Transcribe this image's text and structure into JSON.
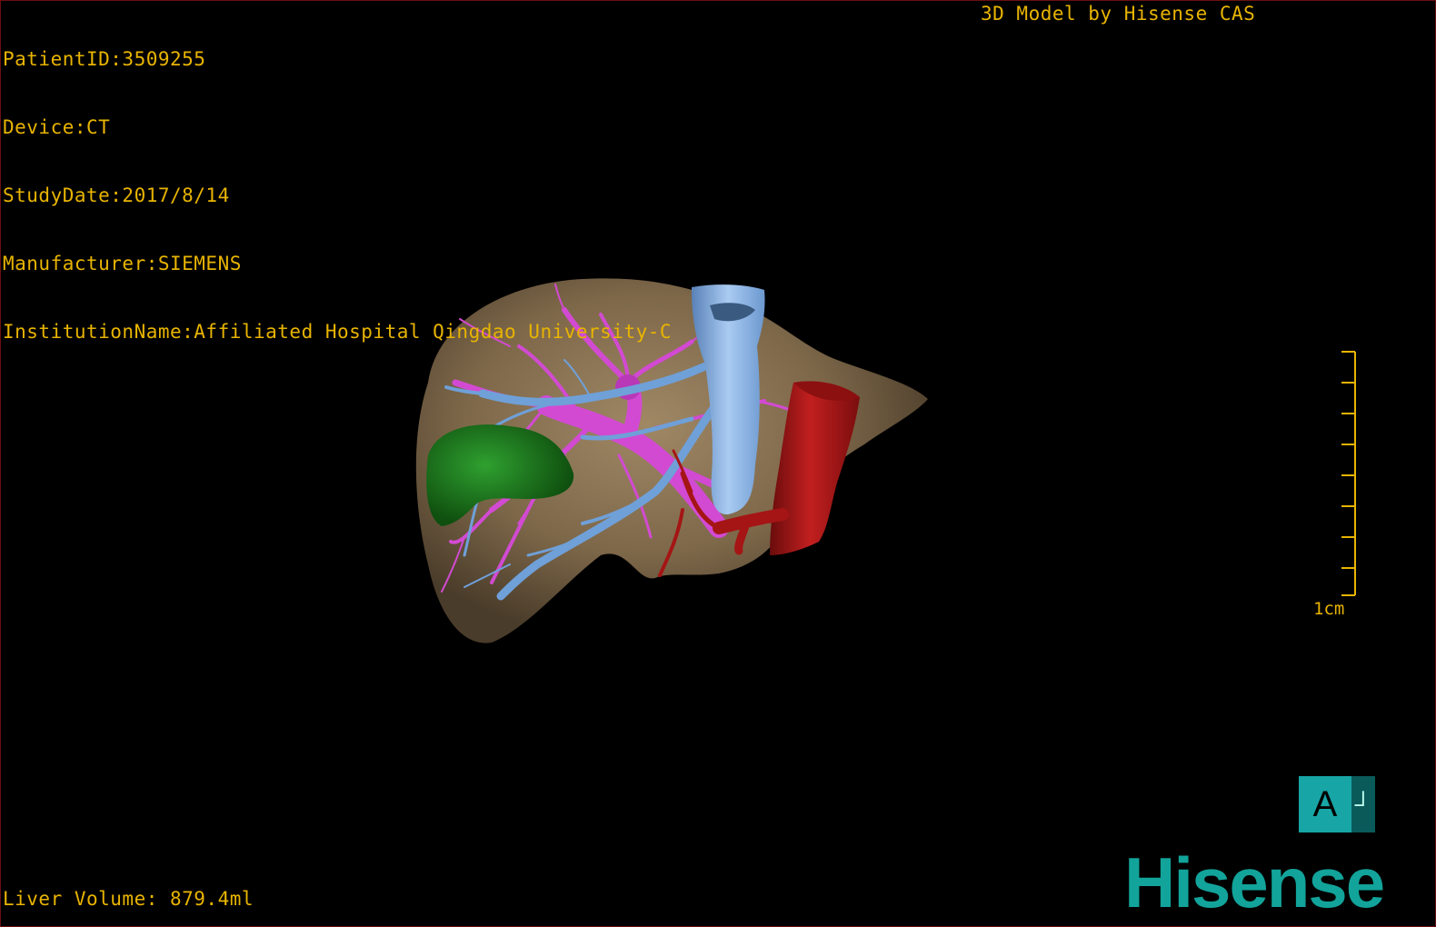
{
  "info": {
    "patient_id": "PatientID:3509255",
    "device": "Device:CT",
    "study_date": "StudyDate:2017/8/14",
    "manufacturer": "Manufacturer:SIEMENS",
    "institution": "InstitutionName:Affiliated Hospital Qingdao University-C"
  },
  "credit": "3D Model by Hisense CAS",
  "volume": "Liver Volume: 879.4ml",
  "scale_bar": {
    "label": "1cm"
  },
  "orientation": {
    "face": "A",
    "side": "┘"
  },
  "brand": "Hisense",
  "colors": {
    "overlay_text": "#e8b400",
    "liver": "#8a7355",
    "gallbladder": "#1f7a1f",
    "portal_vein": "#d24ad2",
    "hepatic_vein": "#6fa0d8",
    "ivc": "#8ab4e6",
    "aorta": "#a51515",
    "orientation_cube": "#18a5a5",
    "brand": "#12a39a"
  }
}
